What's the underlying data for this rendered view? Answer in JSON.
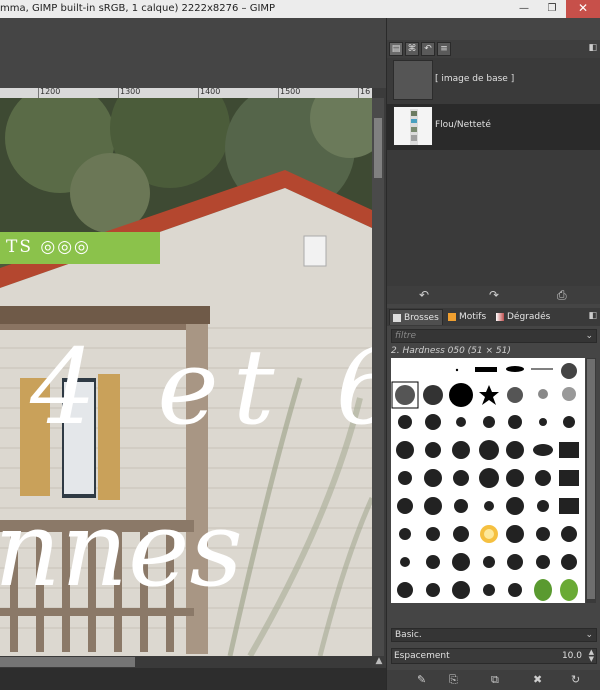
{
  "window": {
    "title": "mma, GIMP built-in sRGB, 1 calque) 2222x8276 – GIMP",
    "min_symbol": "—",
    "max_symbol": "❐",
    "close_symbol": "✕"
  },
  "ruler": {
    "labels": [
      "1200",
      "1300",
      "1400",
      "1500",
      "16"
    ]
  },
  "canvas": {
    "banner_text": "TS ◎◎◎",
    "overlay_main": "4 et 6",
    "overlay_sub": "nnes"
  },
  "layers_panel": {
    "tab_icons": [
      "layers-icon",
      "channels-icon",
      "undo-history-icon",
      "paths-icon"
    ],
    "layers": [
      {
        "name": "[ image de base ]",
        "selected": false
      },
      {
        "name": "Flou/Netteté",
        "selected": true
      }
    ],
    "buttons": [
      "↶",
      "↷",
      "⎙"
    ]
  },
  "brushes_panel": {
    "tabs": [
      {
        "label": "Brosses",
        "color": "#dddddd",
        "active": true
      },
      {
        "label": "Motifs",
        "color": "#f0a030",
        "active": false
      },
      {
        "label": "Dégradés",
        "color": "#d08080",
        "active": false
      }
    ],
    "filter_placeholder": "filtre",
    "brush_info": "2. Hardness 050 (51 × 51)",
    "preset": "Basic.",
    "spacing_label": "Espacement",
    "spacing_value": "10.0",
    "buttons": [
      "✎",
      "⎘",
      "⧉",
      "✖",
      "↻"
    ]
  },
  "colors": {
    "accent_green": "#8bc24b",
    "close_red": "#c7504a"
  }
}
